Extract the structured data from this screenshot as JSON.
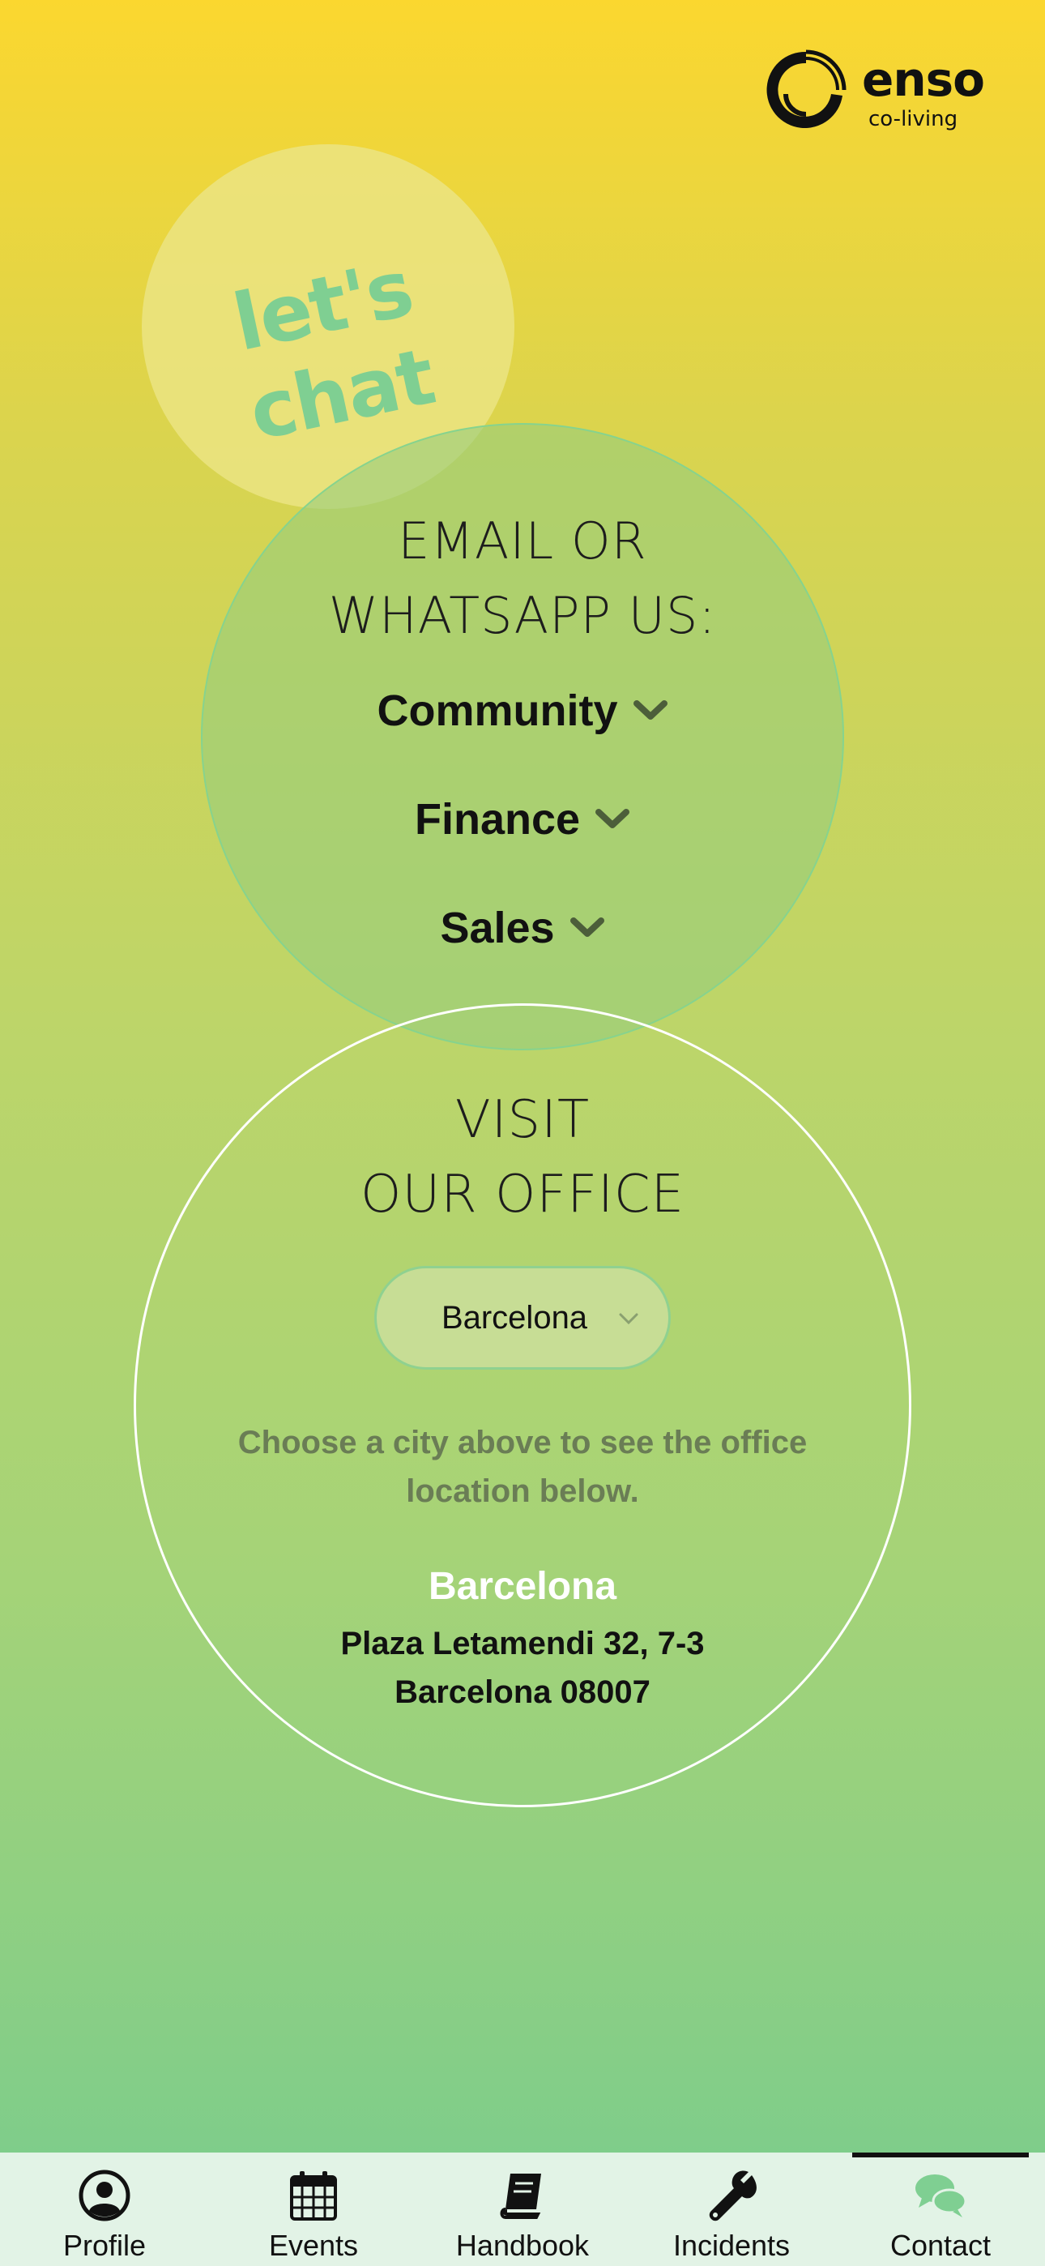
{
  "brand": {
    "name": "enso",
    "subtitle": "co-living"
  },
  "hero": {
    "bubble_text": "let's chat"
  },
  "contact": {
    "title": "EMAIL OR\nWHATSAPP US:",
    "departments": [
      {
        "label": "Community",
        "icon": "chevron-down-icon"
      },
      {
        "label": "Finance",
        "icon": "chevron-down-icon"
      },
      {
        "label": "Sales",
        "icon": "chevron-down-icon"
      }
    ]
  },
  "office": {
    "title": "VISIT\nOUR OFFICE",
    "city_select": {
      "value": "Barcelona",
      "icon": "chevron-down-icon"
    },
    "hint": "Choose a city above to see the office location below.",
    "city": "Barcelona",
    "address_line1": "Plaza Letamendi 32, 7-3",
    "address_line2": "Barcelona 08007"
  },
  "tabs": [
    {
      "label": "Profile",
      "icon": "user-circle-icon",
      "active": false
    },
    {
      "label": "Events",
      "icon": "calendar-icon",
      "active": false
    },
    {
      "label": "Handbook",
      "icon": "book-icon",
      "active": false
    },
    {
      "label": "Incidents",
      "icon": "wrench-icon",
      "active": false
    },
    {
      "label": "Contact",
      "icon": "chat-bubbles-icon",
      "active": true
    }
  ],
  "colors": {
    "accent": "#7fcf92",
    "gradient_top": "#fbd72f",
    "gradient_bottom": "#7fcd8a",
    "tabbar_bg": "#e2f3e6"
  }
}
